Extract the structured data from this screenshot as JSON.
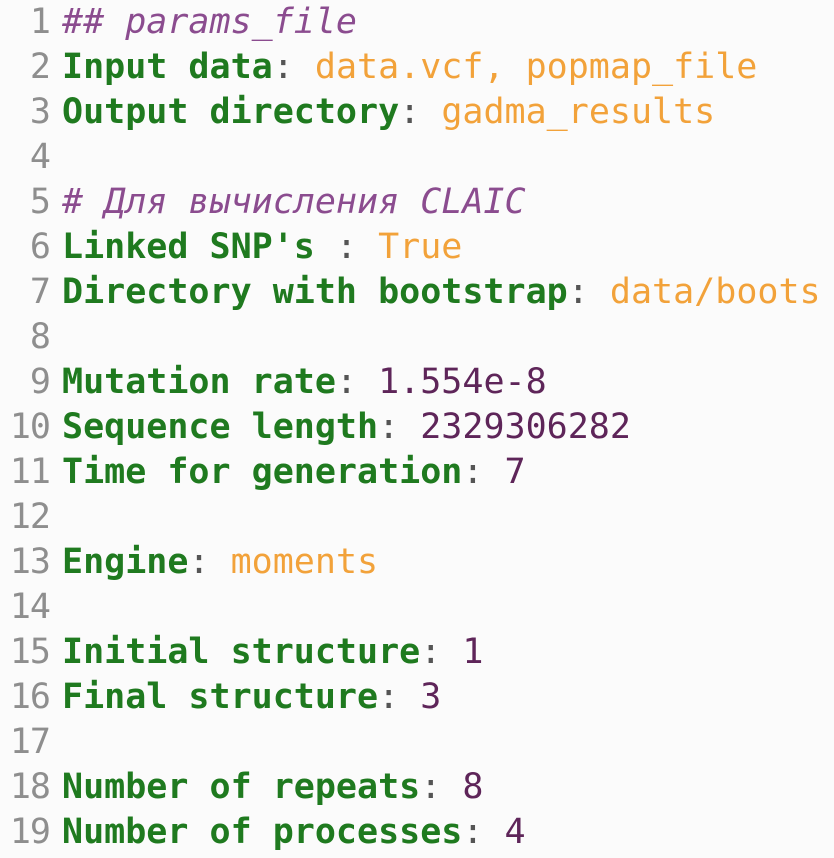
{
  "lines": [
    {
      "n": "1",
      "type": "comment",
      "text": "## params_file"
    },
    {
      "n": "2",
      "type": "kv",
      "key": "Input data",
      "value": "data.vcf, popmap_file",
      "vtype": "str"
    },
    {
      "n": "3",
      "type": "kv",
      "key": "Output directory",
      "value": "gadma_results",
      "vtype": "str"
    },
    {
      "n": "4",
      "type": "blank"
    },
    {
      "n": "5",
      "type": "comment",
      "text": "# Для вычисления CLAIC"
    },
    {
      "n": "6",
      "type": "kv",
      "key": "Linked SNP's",
      "sep": " : ",
      "value": "True",
      "vtype": "str"
    },
    {
      "n": "7",
      "type": "kv",
      "key": "Directory with bootstrap",
      "value": "data/boots",
      "vtype": "str"
    },
    {
      "n": "8",
      "type": "blank"
    },
    {
      "n": "9",
      "type": "kv",
      "key": "Mutation rate",
      "value": "1.554e-8",
      "vtype": "num"
    },
    {
      "n": "10",
      "type": "kv",
      "key": "Sequence length",
      "value": "2329306282",
      "vtype": "num"
    },
    {
      "n": "11",
      "type": "kv",
      "key": "Time for generation",
      "value": "7",
      "vtype": "num"
    },
    {
      "n": "12",
      "type": "blank"
    },
    {
      "n": "13",
      "type": "kv",
      "key": "Engine",
      "value": "moments",
      "vtype": "str"
    },
    {
      "n": "14",
      "type": "blank"
    },
    {
      "n": "15",
      "type": "kv",
      "key": "Initial structure",
      "value": "1",
      "vtype": "num"
    },
    {
      "n": "16",
      "type": "kv",
      "key": "Final structure",
      "value": "3",
      "vtype": "num"
    },
    {
      "n": "17",
      "type": "blank"
    },
    {
      "n": "18",
      "type": "kv",
      "key": "Number of repeats",
      "value": "8",
      "vtype": "num"
    },
    {
      "n": "19",
      "type": "kv",
      "key": "Number of processes",
      "value": "4",
      "vtype": "num"
    }
  ],
  "colors": {
    "comment": "#8b4c8f",
    "key": "#1f7a1f",
    "string": "#f2a23a",
    "number": "#5e2559",
    "line_number": "#8e8e8e"
  }
}
